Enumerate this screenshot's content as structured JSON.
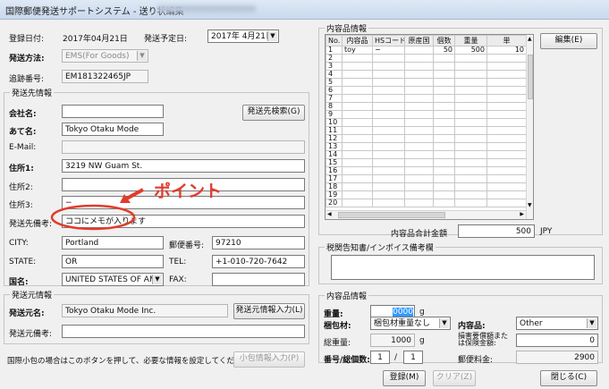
{
  "window": {
    "title": "国際郵便発送サポートシステム - 送り状編集"
  },
  "header": {
    "reg_date_label": "登録日付:",
    "reg_date_value": "2017年04月21日",
    "ship_date_label": "発送予定日:",
    "ship_date_value": "2017年 4月21日",
    "method_label": "発送方法:",
    "method_value": "EMS(For Goods)",
    "tracking_label": "追跡番号:",
    "tracking_value": "EM181322465JP"
  },
  "dest": {
    "group_title": "発送先情報",
    "company_label": "会社名:",
    "company_value": "",
    "search_button": "発送先検索(G)",
    "atena_label": "あて名:",
    "atena_value": "Tokyo Otaku Mode",
    "email_label": "E-Mail:",
    "email_value": "",
    "addr1_label": "住所1:",
    "addr1_value": "3219 NW Guam St.",
    "addr2_label": "住所2:",
    "addr2_value": "",
    "addr3_label": "住所3:",
    "addr3_value": "−",
    "memo_label": "発送先備考:",
    "memo_value": "ココにメモが入ります",
    "city_label": "CITY:",
    "city_value": "Portland",
    "zip_label": "郵便番号:",
    "zip_value": "97210",
    "state_label": "STATE:",
    "state_value": "OR",
    "tel_label": "TEL:",
    "tel_value": "+1-010-720-7642",
    "country_label": "国名:",
    "country_value": "UNITED STATES OF AME",
    "fax_label": "FAX:",
    "fax_value": ""
  },
  "annotation": {
    "text": "ポイント"
  },
  "sender": {
    "group_title": "発送元情報",
    "name_label": "発送元名:",
    "name_value": "Tokyo Otaku Mode Inc.",
    "input_button": "発送元情報入力(L)",
    "memo_label": "発送元備考:",
    "memo_value": ""
  },
  "footer": {
    "note": "国際小包の場合はこのボタンを押して、必要な情報を設定してください。",
    "parcel_button": "小包情報入力(P)"
  },
  "contents": {
    "group_title": "内容品情報",
    "edit_button": "編集(E)",
    "columns": [
      "No.",
      "内容品",
      "HSコード",
      "原産国",
      "個数",
      "重量",
      "単"
    ],
    "rows": [
      [
        "1",
        "toy",
        "−",
        "",
        "50",
        "500",
        "10"
      ],
      [
        "2",
        "",
        "",
        "",
        "",
        "",
        ""
      ],
      [
        "3",
        "",
        "",
        "",
        "",
        "",
        ""
      ],
      [
        "4",
        "",
        "",
        "",
        "",
        "",
        ""
      ],
      [
        "5",
        "",
        "",
        "",
        "",
        "",
        ""
      ],
      [
        "6",
        "",
        "",
        "",
        "",
        "",
        ""
      ],
      [
        "7",
        "",
        "",
        "",
        "",
        "",
        ""
      ],
      [
        "8",
        "",
        "",
        "",
        "",
        "",
        ""
      ],
      [
        "9",
        "",
        "",
        "",
        "",
        "",
        ""
      ],
      [
        "10",
        "",
        "",
        "",
        "",
        "",
        ""
      ],
      [
        "11",
        "",
        "",
        "",
        "",
        "",
        ""
      ],
      [
        "12",
        "",
        "",
        "",
        "",
        "",
        ""
      ],
      [
        "13",
        "",
        "",
        "",
        "",
        "",
        ""
      ],
      [
        "14",
        "",
        "",
        "",
        "",
        "",
        ""
      ],
      [
        "15",
        "",
        "",
        "",
        "",
        "",
        ""
      ],
      [
        "16",
        "",
        "",
        "",
        "",
        "",
        ""
      ],
      [
        "17",
        "",
        "",
        "",
        "",
        "",
        ""
      ],
      [
        "18",
        "",
        "",
        "",
        "",
        "",
        ""
      ],
      [
        "19",
        "",
        "",
        "",
        "",
        "",
        ""
      ],
      [
        "20",
        "",
        "",
        "",
        "",
        "",
        ""
      ]
    ],
    "total_label": "内容品合計金額",
    "total_value": "500",
    "total_unit": "JPY"
  },
  "customs": {
    "group_title": "税関告知書/インボイス備考欄",
    "value": ""
  },
  "package": {
    "group_title": "内容品情報",
    "weight_label": "重量:",
    "weight_value": "0000",
    "weight_unit": "g",
    "packing_label": "梱包材:",
    "packing_value": "梱包材重量なし",
    "content_type_label": "内容品:",
    "content_type_value": "Other",
    "total_weight_label": "総重量:",
    "total_weight_value": "1000",
    "total_weight_unit": "g",
    "insurance_label": "損害要償額または保険金額:",
    "insurance_value": "0",
    "count_label": "番号/総個数:",
    "count_current": "1",
    "count_sep": "/",
    "count_total": "1",
    "postage_label": "郵便料金:",
    "postage_value": "2900"
  },
  "actions": {
    "register": "登録(M)",
    "clear": "クリア(Z)",
    "close": "閉じる(C)"
  },
  "colors": {
    "annotation": "#e23b2c",
    "selection": "#3399ff"
  }
}
